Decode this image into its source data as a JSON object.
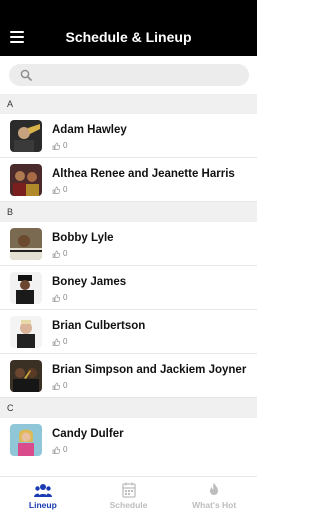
{
  "header": {
    "title": "Schedule & Lineup",
    "menu_icon": "hamburger-icon"
  },
  "search": {
    "placeholder": "",
    "value": "",
    "icon": "search-icon"
  },
  "sections": [
    {
      "letter": "A",
      "artists": [
        {
          "name": "Adam Hawley",
          "likes": "0"
        },
        {
          "name": "Althea Renee and Jeanette Harris",
          "likes": "0"
        }
      ]
    },
    {
      "letter": "B",
      "artists": [
        {
          "name": "Bobby Lyle",
          "likes": "0"
        },
        {
          "name": "Boney James",
          "likes": "0"
        },
        {
          "name": "Brian Culbertson",
          "likes": "0"
        },
        {
          "name": "Brian Simpson and Jackiem Joyner",
          "likes": "0"
        }
      ]
    },
    {
      "letter": "C",
      "artists": [
        {
          "name": "Candy Dulfer",
          "likes": "0"
        }
      ]
    }
  ],
  "tabs": [
    {
      "label": "Lineup",
      "icon": "group-icon",
      "active": true
    },
    {
      "label": "Schedule",
      "icon": "calendar-icon",
      "active": false
    },
    {
      "label": "What's Hot",
      "icon": "flame-icon",
      "active": false
    }
  ],
  "colors": {
    "header_bg": "#000000",
    "accent": "#1a3bb3",
    "inactive": "#bdbdbd",
    "section_bg": "#f0f0f0"
  }
}
